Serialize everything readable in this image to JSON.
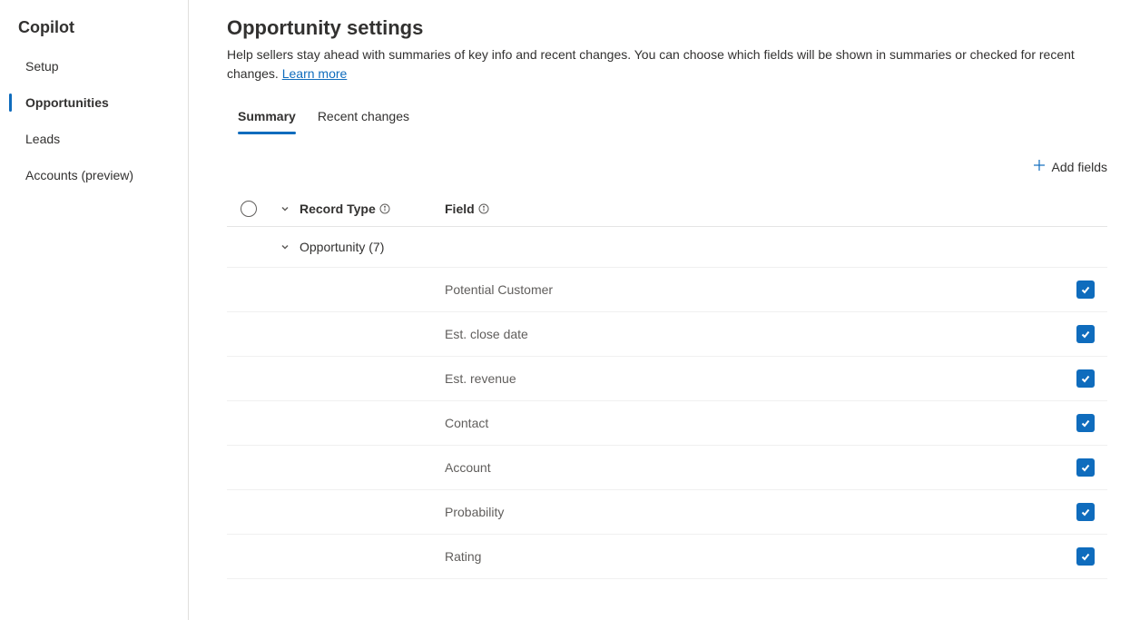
{
  "sidebar": {
    "title": "Copilot",
    "items": [
      {
        "label": "Setup",
        "active": false
      },
      {
        "label": "Opportunities",
        "active": true
      },
      {
        "label": "Leads",
        "active": false
      },
      {
        "label": "Accounts (preview)",
        "active": false
      }
    ]
  },
  "page": {
    "title": "Opportunity settings",
    "description": "Help sellers stay ahead with summaries of key info and recent changes. You can choose which fields will be shown in summaries or checked for recent changes. ",
    "learn_more": "Learn more"
  },
  "tabs": [
    {
      "label": "Summary",
      "active": true
    },
    {
      "label": "Recent changes",
      "active": false
    }
  ],
  "actions": {
    "add_fields": "Add fields"
  },
  "table": {
    "headers": {
      "record_type": "Record Type",
      "field": "Field"
    },
    "group": {
      "label": "Opportunity (7)"
    },
    "rows": [
      {
        "field": "Potential Customer",
        "checked": true
      },
      {
        "field": "Est. close date",
        "checked": true
      },
      {
        "field": "Est. revenue",
        "checked": true
      },
      {
        "field": "Contact",
        "checked": true
      },
      {
        "field": "Account",
        "checked": true
      },
      {
        "field": "Probability",
        "checked": true
      },
      {
        "field": "Rating",
        "checked": true
      }
    ]
  }
}
